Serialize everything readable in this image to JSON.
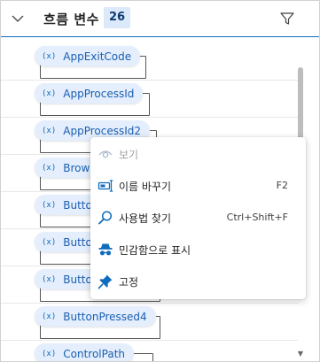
{
  "header": {
    "title": "흐름 변수",
    "count": "26"
  },
  "variables": [
    {
      "name": "AppExitCode"
    },
    {
      "name": "AppProcessId"
    },
    {
      "name": "AppProcessId2"
    },
    {
      "name": "BrowserPage"
    },
    {
      "name": "ButtonPressed"
    },
    {
      "name": "ButtonPressed2"
    },
    {
      "name": "ButtonPressed3"
    },
    {
      "name": "ButtonPressed4"
    },
    {
      "name": "ControlPath"
    }
  ],
  "context_menu": {
    "items": [
      {
        "label": "보기",
        "shortcut": "",
        "icon": "eye-icon",
        "enabled": false
      },
      {
        "label": "이름 바꾸기",
        "shortcut": "F2",
        "icon": "rename-icon",
        "enabled": true
      },
      {
        "label": "사용법 찾기",
        "shortcut": "Ctrl+Shift+F",
        "icon": "search-icon",
        "enabled": true
      },
      {
        "label": "민감함으로 표시",
        "shortcut": "",
        "icon": "incognito-icon",
        "enabled": true
      },
      {
        "label": "고정",
        "shortcut": "",
        "icon": "pin-icon",
        "enabled": true
      }
    ]
  },
  "colors": {
    "accent": "#0f6cbd",
    "chip_bg": "#e4eefc",
    "count_bg": "#dbe9fb"
  }
}
